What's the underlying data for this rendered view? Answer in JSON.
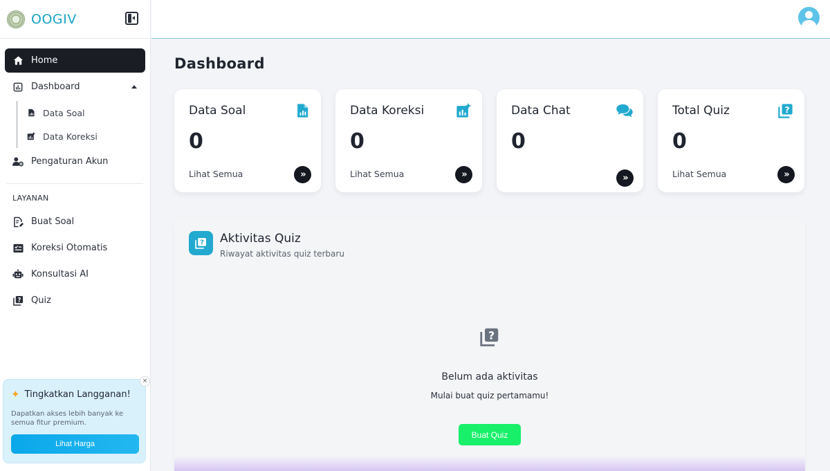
{
  "brand": {
    "name": "OOGIV"
  },
  "sidebar": {
    "items": [
      {
        "label": "Home",
        "icon": "home-icon"
      },
      {
        "label": "Dashboard",
        "icon": "dashboard-icon"
      },
      {
        "label": "Data Soal",
        "icon": "file-chart-icon"
      },
      {
        "label": "Data Koreksi",
        "icon": "chart-sparkle-icon"
      },
      {
        "label": "Pengaturan Akun",
        "icon": "user-cog-icon"
      }
    ],
    "section_label": "LAYANAN",
    "services": [
      {
        "label": "Buat Soal",
        "icon": "file-edit-icon"
      },
      {
        "label": "Koreksi Otomatis",
        "icon": "checklist-icon"
      },
      {
        "label": "Konsultasi AI",
        "icon": "robot-icon"
      },
      {
        "label": "Quiz",
        "icon": "quiz-icon"
      }
    ]
  },
  "upgrade": {
    "close": "×",
    "title": "Tingkatkan Langganan!",
    "description": "Dapatkan akses lebih banyak ke semua fitur premium.",
    "button": "Lihat Harga",
    "accent": "#0aa8ea"
  },
  "main": {
    "title": "Dashboard",
    "cards": [
      {
        "title": "Data Soal",
        "value": "0",
        "link": "Lihat Semua",
        "icon": "file-chart-icon"
      },
      {
        "title": "Data Koreksi",
        "value": "0",
        "link": "Lihat Semua",
        "icon": "chart-sparkle-icon"
      },
      {
        "title": "Data Chat",
        "value": "0",
        "link": "",
        "icon": "chat-bubbles-icon"
      },
      {
        "title": "Total Quiz",
        "value": "0",
        "link": "Lihat Semua",
        "icon": "quiz-icon"
      }
    ],
    "arrow": "»",
    "activity": {
      "title": "Aktivitas Quiz",
      "subtitle": "Riwayat aktivitas quiz terbaru",
      "empty_title": "Belum ada aktivitas",
      "empty_subtitle": "Mulai buat quiz pertamamu!",
      "cta": "Buat Quiz",
      "cta_color": "#18f06a"
    }
  },
  "colors": {
    "accent": "#22a9cf",
    "dark": "#151821",
    "brand": "#1aa3c7"
  }
}
